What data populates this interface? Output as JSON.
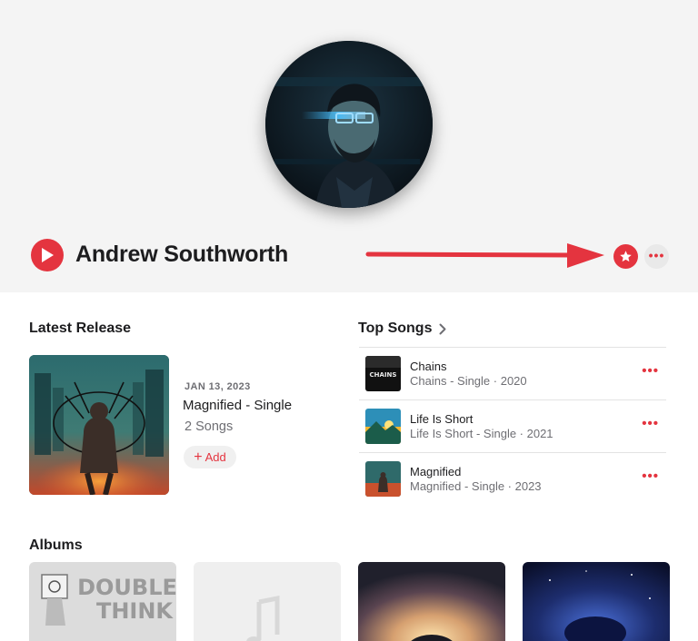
{
  "artist": {
    "name": "Andrew Southworth",
    "play_icon": "play-icon",
    "favorite_icon": "star-icon",
    "more_icon": "ellipsis-icon",
    "more_label": "•••"
  },
  "colors": {
    "accent": "#e4343f",
    "hero_background": "#f4f4f4",
    "secondary_text": "#6e6e73"
  },
  "latest_release": {
    "heading": "Latest Release",
    "date": "JAN 13, 2023",
    "title": "Magnified - Single",
    "count": "2 Songs",
    "add_label": "Add",
    "add_plus": "+"
  },
  "top_songs": {
    "heading": "Top Songs",
    "chevron": "›",
    "items": [
      {
        "title": "Chains",
        "subtitle": "Chains - Single · 2020",
        "more": "•••",
        "art_text": "CHAINS"
      },
      {
        "title": "Life Is Short",
        "subtitle": "Life Is Short - Single · 2021",
        "more": "•••"
      },
      {
        "title": "Magnified",
        "subtitle": "Magnified - Single · 2023",
        "more": "•••"
      }
    ]
  },
  "albums": {
    "heading": "Albums",
    "items": [
      {
        "art_text_1": "DOUBLE",
        "art_text_2": "THINK"
      },
      {
        "placeholder_icon": "music-note-icon"
      },
      {},
      {}
    ]
  }
}
